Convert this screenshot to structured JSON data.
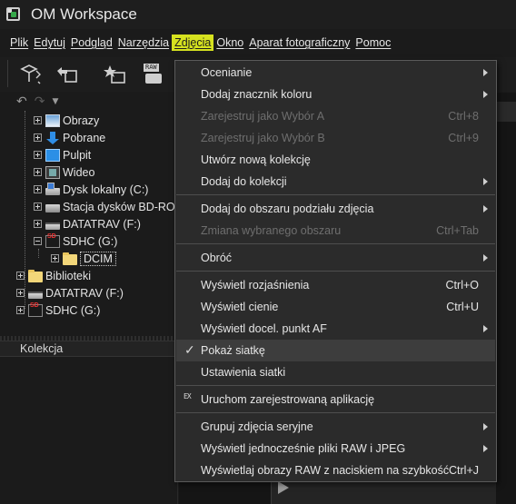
{
  "window": {
    "title": "OM Workspace",
    "app_icon": "om-workspace-icon"
  },
  "menubar": [
    {
      "label": "Plik",
      "active": false
    },
    {
      "label": "Edytuj",
      "active": false
    },
    {
      "label": "Podgląd",
      "active": false
    },
    {
      "label": "Narzędzia",
      "active": false
    },
    {
      "label": "Zdjęcia",
      "active": true
    },
    {
      "label": "Okno",
      "active": false
    },
    {
      "label": "Aparat fotograficzny",
      "active": false
    },
    {
      "label": "Pomoc",
      "active": false
    }
  ],
  "toolbar": {
    "raw_badge": "RAW"
  },
  "tree": {
    "items": [
      {
        "label": "Obrazy",
        "icon": "pictures-folder-icon"
      },
      {
        "label": "Pobrane",
        "icon": "downloads-icon"
      },
      {
        "label": "Pulpit",
        "icon": "desktop-icon"
      },
      {
        "label": "Wideo",
        "icon": "videos-icon"
      },
      {
        "label": "Dysk lokalny (C:)",
        "icon": "local-disk-icon"
      },
      {
        "label": "Stacja dysków BD-ROM",
        "icon": "bd-rom-drive-icon"
      },
      {
        "label": "DATATRAV (F:)",
        "icon": "usb-drive-icon"
      },
      {
        "label": "SDHC (G:)",
        "icon": "sd-card-icon"
      },
      {
        "label": "DCIM",
        "icon": "folder-icon"
      },
      {
        "label": "Biblioteki",
        "icon": "libraries-icon"
      },
      {
        "label": "DATATRAV (F:)",
        "icon": "usb-drive-icon"
      },
      {
        "label": "SDHC (G:)",
        "icon": "sd-card-icon"
      }
    ]
  },
  "collections_panel": {
    "title": "Kolekcja"
  },
  "dropdown": {
    "items": [
      {
        "label": "Ocenianie",
        "shortcut": "",
        "submenu": true,
        "disabled": false
      },
      {
        "label": "Dodaj znacznik koloru",
        "shortcut": "",
        "submenu": true,
        "disabled": false
      },
      {
        "label": "Zarejestruj jako Wybór A",
        "shortcut": "Ctrl+8",
        "submenu": false,
        "disabled": true
      },
      {
        "label": "Zarejestruj jako Wybór B",
        "shortcut": "Ctrl+9",
        "submenu": false,
        "disabled": true
      },
      {
        "label": "Utwórz nową kolekcję",
        "shortcut": "",
        "submenu": false,
        "disabled": false
      },
      {
        "label": "Dodaj do kolekcji",
        "shortcut": "",
        "submenu": true,
        "disabled": false
      },
      {
        "label": "Dodaj do obszaru podziału zdjęcia",
        "shortcut": "",
        "submenu": true,
        "disabled": false
      },
      {
        "label": "Zmiana wybranego obszaru",
        "shortcut": "Ctrl+Tab",
        "submenu": false,
        "disabled": true
      },
      {
        "label": "Obróć",
        "shortcut": "",
        "submenu": true,
        "disabled": false
      },
      {
        "label": "Wyświetl rozjaśnienia",
        "shortcut": "Ctrl+O",
        "submenu": false,
        "disabled": false
      },
      {
        "label": "Wyświetl cienie",
        "shortcut": "Ctrl+U",
        "submenu": false,
        "disabled": false
      },
      {
        "label": "Wyświetl docel. punkt AF",
        "shortcut": "",
        "submenu": true,
        "disabled": false
      },
      {
        "label": "Pokaż siatkę",
        "shortcut": "",
        "submenu": false,
        "disabled": false,
        "checked": true
      },
      {
        "label": "Ustawienia siatki",
        "shortcut": "",
        "submenu": false,
        "disabled": false
      },
      {
        "label": "Uruchom zarejestrowaną aplikację",
        "shortcut": "",
        "submenu": false,
        "disabled": false,
        "icon_text": "EX"
      },
      {
        "label": "Grupuj zdjęcia seryjne",
        "shortcut": "",
        "submenu": true,
        "disabled": false
      },
      {
        "label": "Wyświetl jednocześnie pliki RAW i JPEG",
        "shortcut": "",
        "submenu": true,
        "disabled": false
      },
      {
        "label": "Wyświetlaj obrazy RAW z naciskiem na szybkość",
        "shortcut": "Ctrl+J",
        "submenu": false,
        "disabled": false
      }
    ]
  }
}
